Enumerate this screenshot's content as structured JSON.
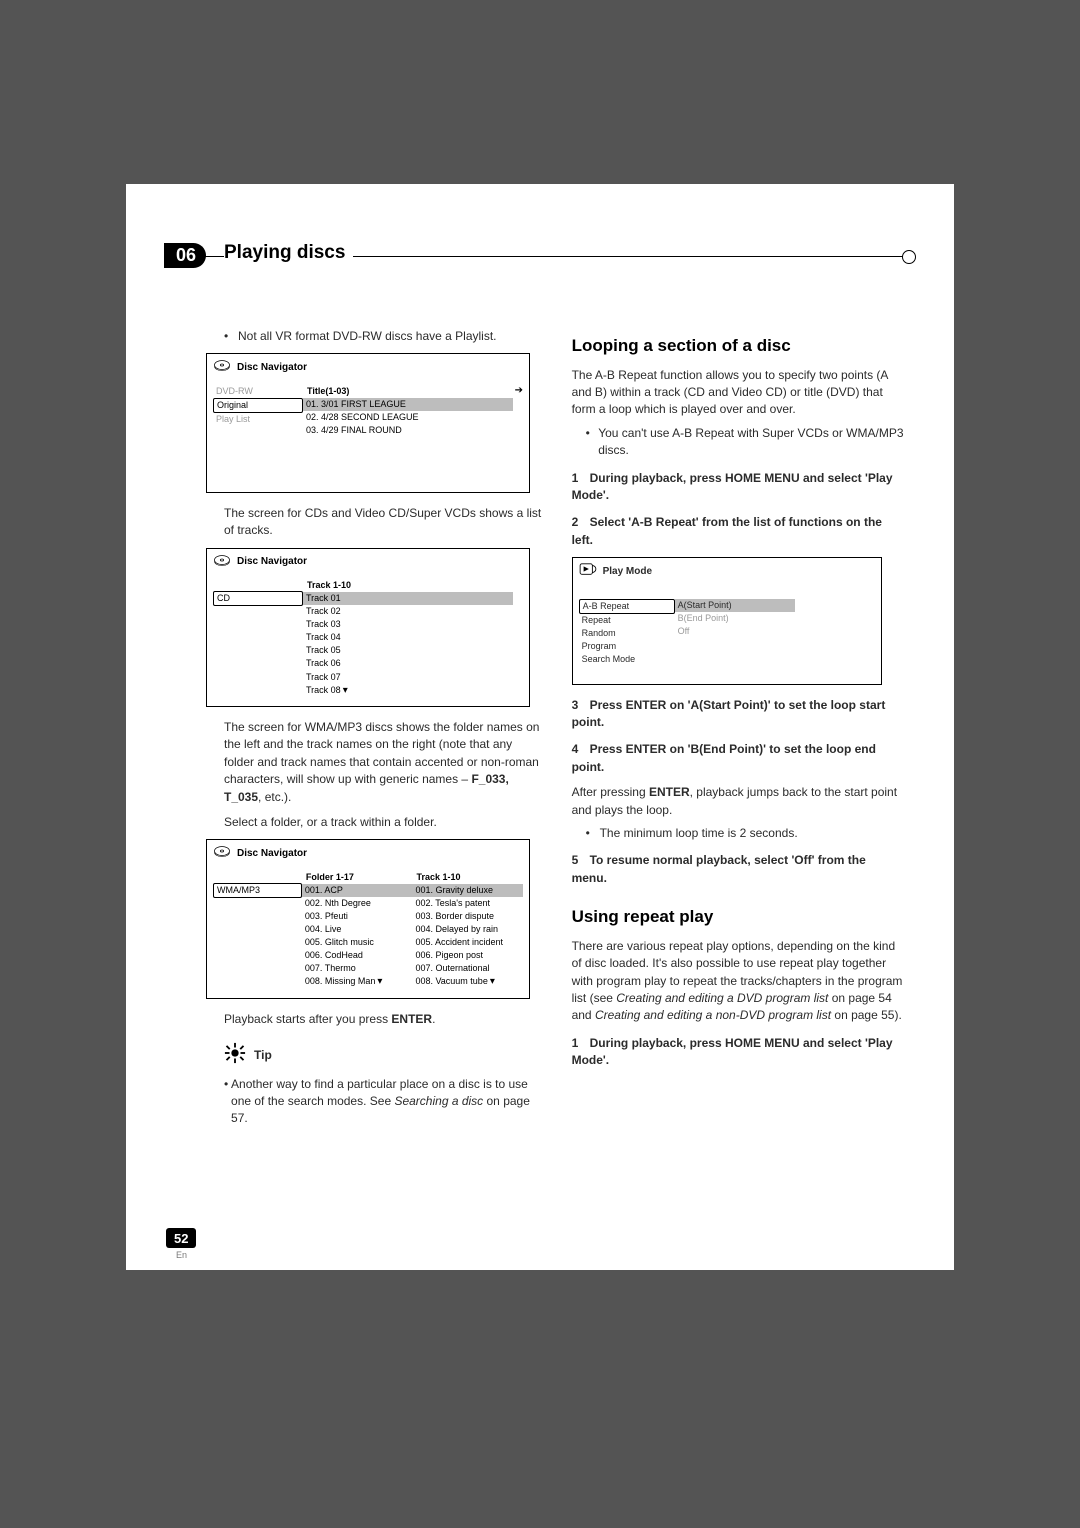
{
  "chapter": {
    "number": "06",
    "title": "Playing discs"
  },
  "left": {
    "vr_note": "Not all VR format DVD-RW discs have a Playlist.",
    "osd1": {
      "title": "Disc Navigator",
      "left_label": "DVD-RW",
      "original": "Original",
      "play_list": "Play List",
      "mid_header": "Title(1-03)",
      "rows": [
        "01. 3/01 FIRST LEAGUE",
        "02. 4/28 SECOND LEAGUE",
        "03. 4/29 FINAL ROUND"
      ]
    },
    "cd_para": "The screen for CDs and Video CD/Super VCDs shows a list of tracks.",
    "osd2": {
      "title": "Disc Navigator",
      "left_label": "CD",
      "mid_header": "Track 1-10",
      "rows": [
        "Track 01",
        "Track 02",
        "Track 03",
        "Track 04",
        "Track 05",
        "Track 06",
        "Track 07",
        "Track 08"
      ]
    },
    "wma_para": "The screen for WMA/MP3 discs shows the folder names on the left and the track names on the right (note that any folder and track names that contain accented or non-roman characters, will show up with generic names – ",
    "wma_bold": "F_033, T_035",
    "wma_tail": ", etc.).",
    "select_folder": "Select a folder, or a track within a folder.",
    "osd3": {
      "title": "Disc Navigator",
      "left_label": "WMA/MP3",
      "mid_header": "Folder 1-17",
      "right_header": "Track 1-10",
      "folders": [
        "001. ACP",
        "002. Nth Degree",
        "003. Pfeuti",
        "004. Live",
        "005. Glitch music",
        "006. CodHead",
        "007. Thermo",
        "008. Missing Man"
      ],
      "tracks": [
        "001. Gravity deluxe",
        "002. Tesla's patent",
        "003. Border dispute",
        "004. Delayed by rain",
        "005. Accident incident",
        "006. Pigeon post",
        "007. Outernational",
        "008. Vacuum tube"
      ]
    },
    "playback_line_pre": "Playback starts after you press ",
    "playback_line_bold": "ENTER",
    "tip_label": "Tip",
    "tip_text_pre": "Another way to find a particular place on a disc is to use one of the search modes. See ",
    "tip_text_italic": "Searching a disc",
    "tip_text_post": " on page 57."
  },
  "right": {
    "h_loop": "Looping a section of a disc",
    "loop_intro": "The A-B Repeat function allows you to specify two points (A and B) within a track (CD and Video CD) or title (DVD) that form a loop which is played over and over.",
    "loop_bullet": "You can't use A-B Repeat with Super VCDs or WMA/MP3 discs.",
    "step1": "During playback, press HOME MENU and select 'Play Mode'.",
    "step2": "Select 'A-B Repeat' from the list of functions on the left.",
    "osd_play": {
      "title": "Play Mode",
      "left": [
        "A-B Repeat",
        "Repeat",
        "Random",
        "Program",
        "Search Mode"
      ],
      "right": [
        "A(Start Point)",
        "B(End Point)",
        "Off"
      ]
    },
    "step3": "Press ENTER on 'A(Start Point)' to set the loop start point.",
    "step4": "Press ENTER on 'B(End Point)' to set the loop end point.",
    "after_enter_pre": "After pressing ",
    "after_enter_bold": "ENTER",
    "after_enter_post": ", playback jumps back to the start point and plays the loop.",
    "min_loop": "The minimum loop time is 2 seconds.",
    "step5": "To resume normal playback, select 'Off' from the menu.",
    "h_repeat": "Using repeat play",
    "repeat_intro_pre": "There are various repeat play options, depending on the kind of disc loaded. It's also possible to use repeat play together with program play to repeat the tracks/chapters in the program list (see ",
    "repeat_italic1": "Creating and editing a DVD program list",
    "repeat_mid": " on page 54 and ",
    "repeat_italic2": "Creating and editing a non-DVD program list",
    "repeat_post": " on page 55).",
    "step1b": "During playback, press HOME MENU and select 'Play Mode'."
  },
  "page_number": "52",
  "page_lang": "En",
  "icons": {
    "arrow_right": "➔",
    "arrow_down": "▾"
  }
}
